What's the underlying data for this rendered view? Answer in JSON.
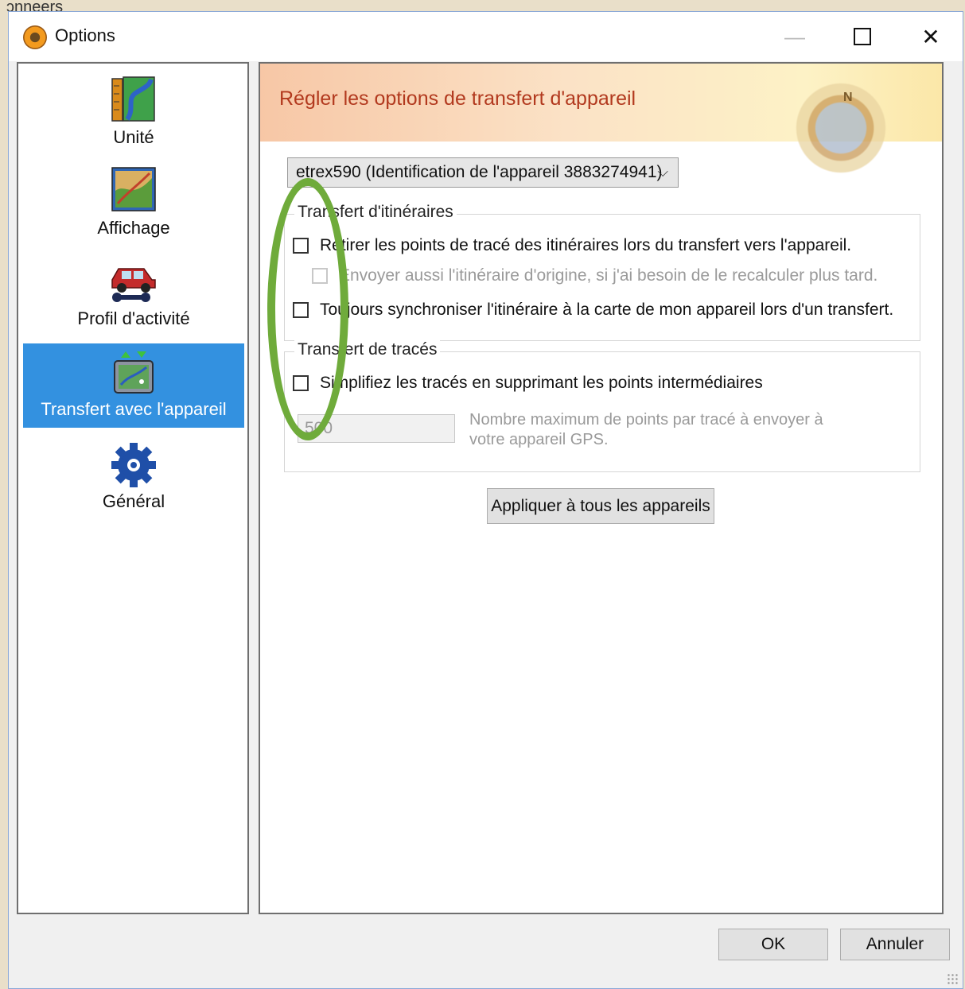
{
  "background": {
    "partial_text": "ɔnneers"
  },
  "window": {
    "title": "Options",
    "icon": "app-compass-icon",
    "controls": {
      "minimize": "—",
      "close": "✕"
    }
  },
  "sidebar": {
    "items": [
      {
        "label": "Unité",
        "icon": "ruler-map-icon",
        "active": false
      },
      {
        "label": "Affichage",
        "icon": "map-display-icon",
        "active": false
      },
      {
        "label": "Profil d'activité",
        "icon": "car-wrench-icon",
        "active": false
      },
      {
        "label": "Transfert avec l'appareil",
        "icon": "device-transfer-icon",
        "active": true
      },
      {
        "label": "Général",
        "icon": "gear-icon",
        "active": false
      }
    ]
  },
  "panel": {
    "banner_title": "Régler les options de transfert d'appareil",
    "compass_letter": "N",
    "device_select": {
      "value": "etrex590 (Identification de l'appareil 3883274941)",
      "chevron": "⌵"
    },
    "route_group": {
      "legend": "Transfert d'itinéraires",
      "options": [
        {
          "label": "Retirer les points de tracé des itinéraires lors du transfert vers l'appareil.",
          "checked": false,
          "enabled": true
        },
        {
          "label": "Envoyer aussi l'itinéraire d'origine, si j'ai besoin de le recalculer plus tard.",
          "checked": false,
          "enabled": false
        },
        {
          "label": "Toujours synchroniser l'itinéraire à la carte de mon appareil lors d'un transfert.",
          "checked": false,
          "enabled": true
        }
      ]
    },
    "track_group": {
      "legend": "Transfert de tracés",
      "option": {
        "label": "Simplifiez les tracés en supprimant les points intermédiaires",
        "checked": false,
        "enabled": true
      },
      "max_points_value": "500",
      "max_points_help": "Nombre maximum de points par tracé à envoyer à votre appareil GPS."
    },
    "apply_button": "Appliquer à tous les appareils"
  },
  "footer": {
    "ok": "OK",
    "cancel": "Annuler"
  },
  "colors": {
    "accent_selection": "#3391e0",
    "banner_title": "#b2391e",
    "annotation_ellipse": "#6fab3b"
  }
}
